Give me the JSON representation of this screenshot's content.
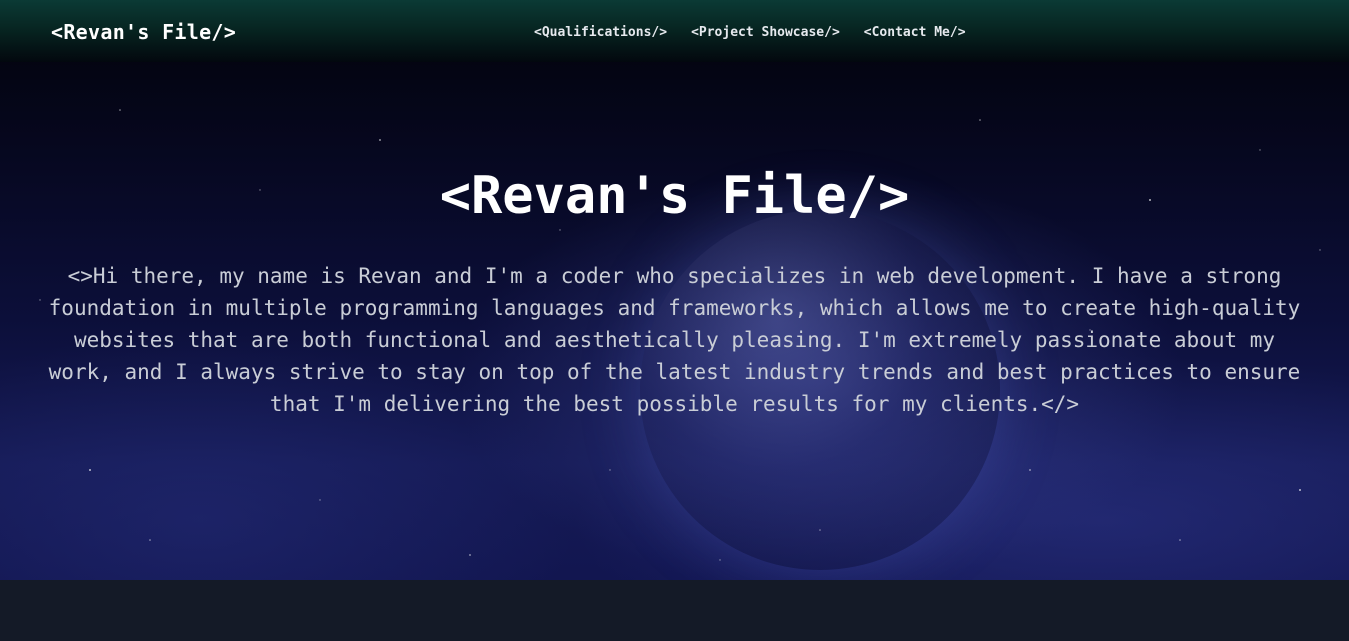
{
  "navbar": {
    "brand": "<Revan's File/>",
    "links": [
      "<Qualifications/>",
      "<Project Showcase/>",
      "<Contact Me/>"
    ]
  },
  "hero": {
    "title": "<Revan's File/>",
    "intro": "<>Hi there, my name is Revan and I'm a coder who specializes in web development. I have a strong foundation in multiple programming languages and frameworks, which allows me to create high-quality websites that are both functional and aesthetically pleasing. I'm extremely passionate about my work, and I always strive to stay on top of the latest industry trends and best practices to ensure that I'm delivering the best possible results for my clients.</>"
  },
  "colors": {
    "navbar_top": "#0b3a35",
    "hero_text": "#c9cdd6",
    "footer_band": "#141a27"
  }
}
